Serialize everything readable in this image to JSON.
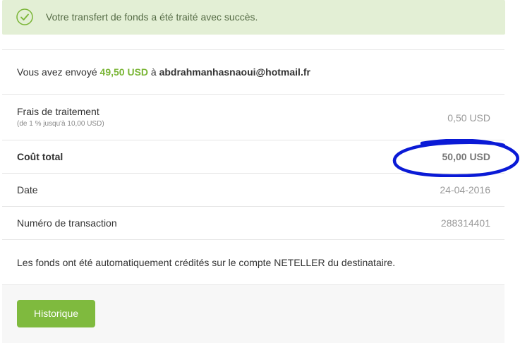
{
  "alert": {
    "icon": "check-circle-icon",
    "message": "Votre transfert de fonds a été traité avec succès."
  },
  "summary": {
    "sent_prefix": "Vous avez envoyé",
    "sent_amount": "49,50 USD",
    "sent_to_word": "à",
    "recipient": "abdrahmanhasnaoui@hotmail.fr"
  },
  "details": {
    "fee_label": "Frais de traitement",
    "fee_note": "(de 1 % jusqu'à 10,00 USD)",
    "fee_value": "0,50 USD",
    "total_label": "Coût total",
    "total_value": "50,00 USD",
    "date_label": "Date",
    "date_value": "24-04-2016",
    "tx_label": "Numéro de transaction",
    "tx_value": "288314401"
  },
  "info": {
    "message": "Les fonds ont été automatiquement crédités sur le compte NETELLER du destinataire."
  },
  "footer": {
    "history_button": "Historique"
  },
  "colors": {
    "brand_green": "#7fba3e",
    "alert_bg": "#e3efd5",
    "annotation_blue": "#0a1ad6"
  }
}
